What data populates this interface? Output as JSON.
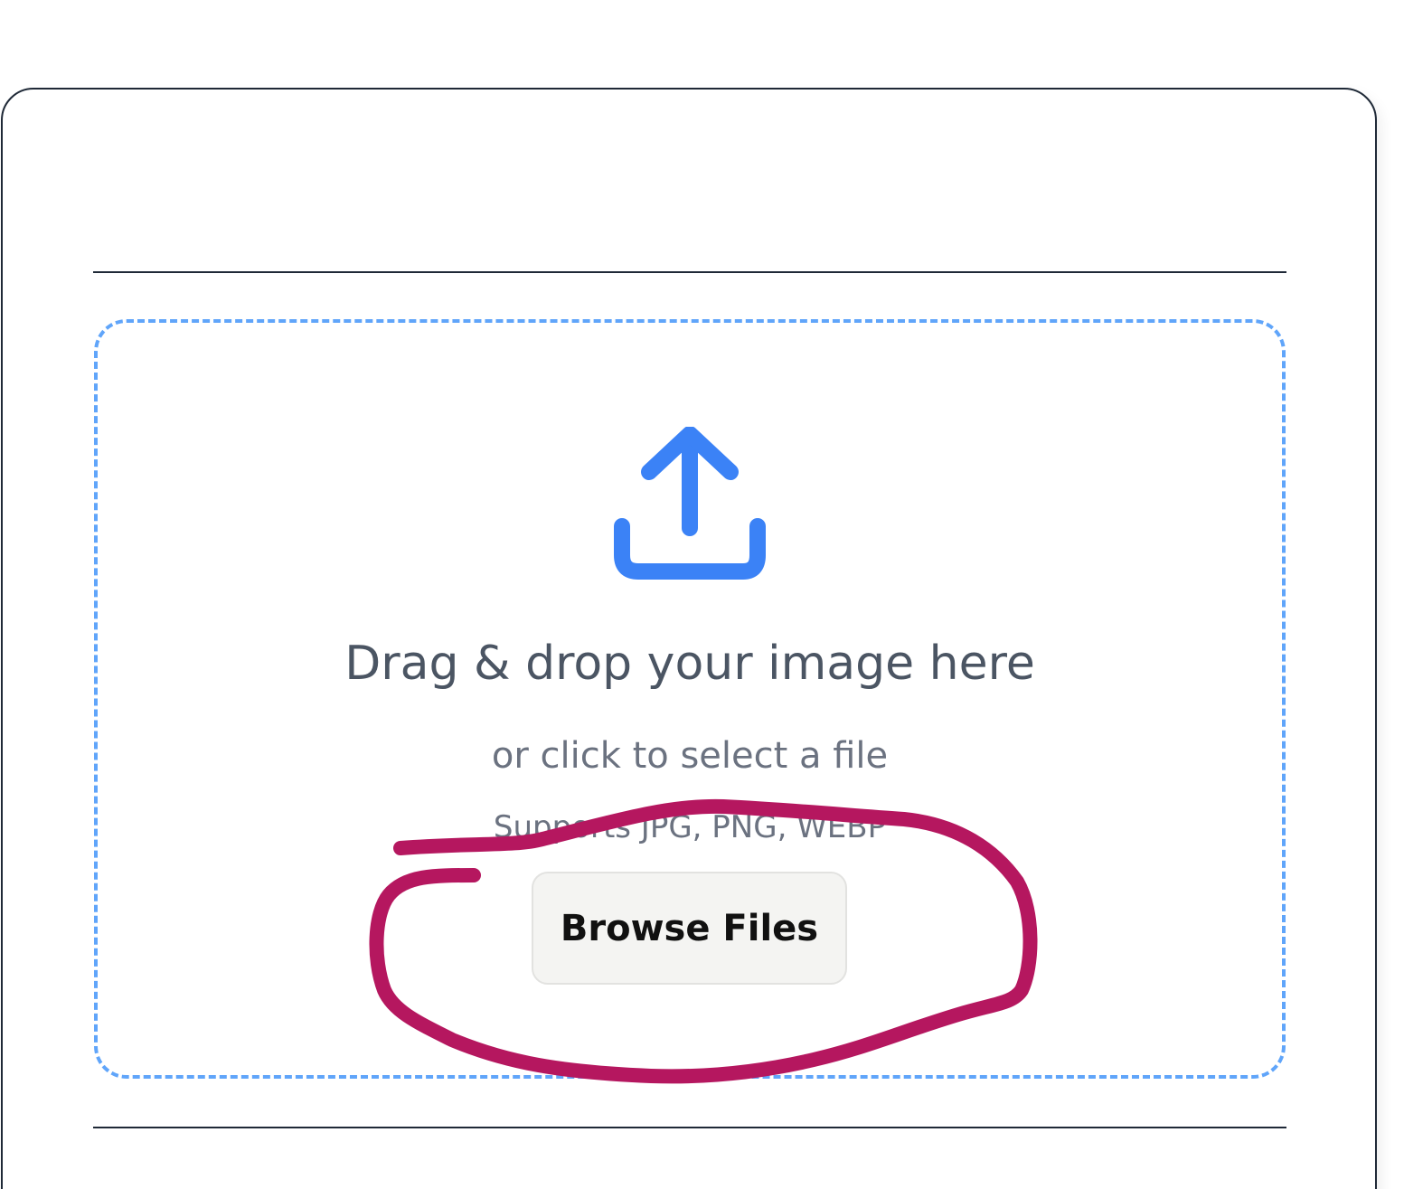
{
  "upload": {
    "headline": "Drag & drop your image here",
    "subline": "or click to select a file",
    "supports": "Supports JPG, PNG, WEBP",
    "browse_label": "Browse Files",
    "icon": "upload-icon"
  },
  "colors": {
    "accent": "#3b82f6",
    "dropzone_border": "#60a5fa",
    "annotation": "#b5175f",
    "card_border": "#1f2937"
  }
}
